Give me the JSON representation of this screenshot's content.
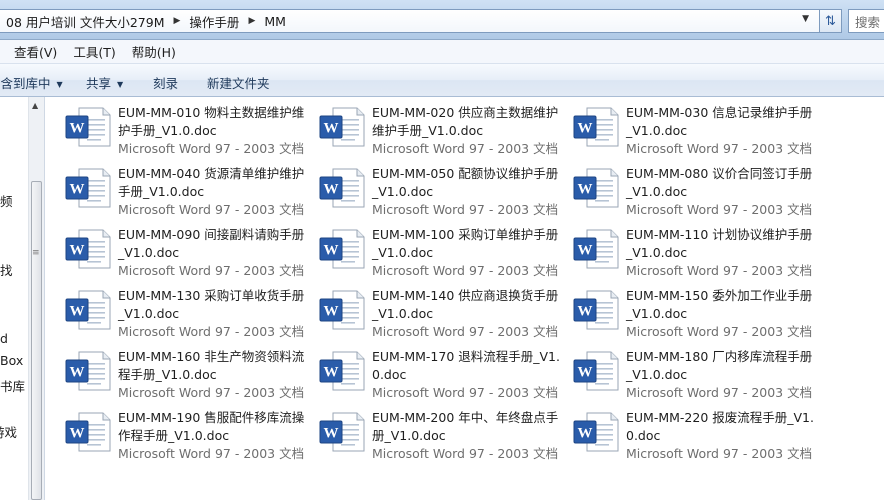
{
  "address_bar": {
    "crumbs": [
      "08 用户培训 文件大小279M",
      "操作手册",
      "MM"
    ],
    "search_placeholder": "搜索"
  },
  "menu": {
    "items": [
      "查看(V)",
      "工具(T)",
      "帮助(H)"
    ]
  },
  "command_bar": {
    "include_in_library": "包含到库中",
    "share": "共享",
    "burn": "刻录",
    "new_folder": "新建文件夹"
  },
  "nav_pane": {
    "items": [
      "频",
      "找",
      "d",
      "Box",
      "书库",
      "游戏"
    ]
  },
  "file_type_label": "Microsoft Word 97 - 2003 文档",
  "files": [
    {
      "name": "EUM-MM-010 物料主数据维护维护手册_V1.0.doc"
    },
    {
      "name": "EUM-MM-020 供应商主数据维护维护手册_V1.0.doc"
    },
    {
      "name": "EUM-MM-030 信息记录维护手册_V1.0.doc"
    },
    {
      "name": "EUM-MM-040 货源清单维护维护手册_V1.0.doc"
    },
    {
      "name": "EUM-MM-050 配额协议维护手册_V1.0.doc"
    },
    {
      "name": "EUM-MM-080 议价合同签订手册_V1.0.doc"
    },
    {
      "name": "EUM-MM-090 间接副料请购手册_V1.0.doc"
    },
    {
      "name": "EUM-MM-100 采购订单维护手册_V1.0.doc"
    },
    {
      "name": "EUM-MM-110 计划协议维护手册_V1.0.doc"
    },
    {
      "name": "EUM-MM-130 采购订单收货手册_V1.0.doc"
    },
    {
      "name": "EUM-MM-140 供应商退换货手册_V1.0.doc"
    },
    {
      "name": "EUM-MM-150 委外加工作业手册_V1.0.doc"
    },
    {
      "name": "EUM-MM-160 非生产物资领料流程手册_V1.0.doc"
    },
    {
      "name": "EUM-MM-170 退料流程手册_V1.0.doc"
    },
    {
      "name": "EUM-MM-180 厂内移库流程手册_V1.0.doc"
    },
    {
      "name": "EUM-MM-190 售服配件移库流操作程手册_V1.0.doc"
    },
    {
      "name": "EUM-MM-200 年中、年终盘点手册_V1.0.doc"
    },
    {
      "name": "EUM-MM-220 报废流程手册_V1.0.doc"
    }
  ],
  "colors": {
    "word_blue": "#2a5caa",
    "secondary_text": "#6e6e6e"
  }
}
